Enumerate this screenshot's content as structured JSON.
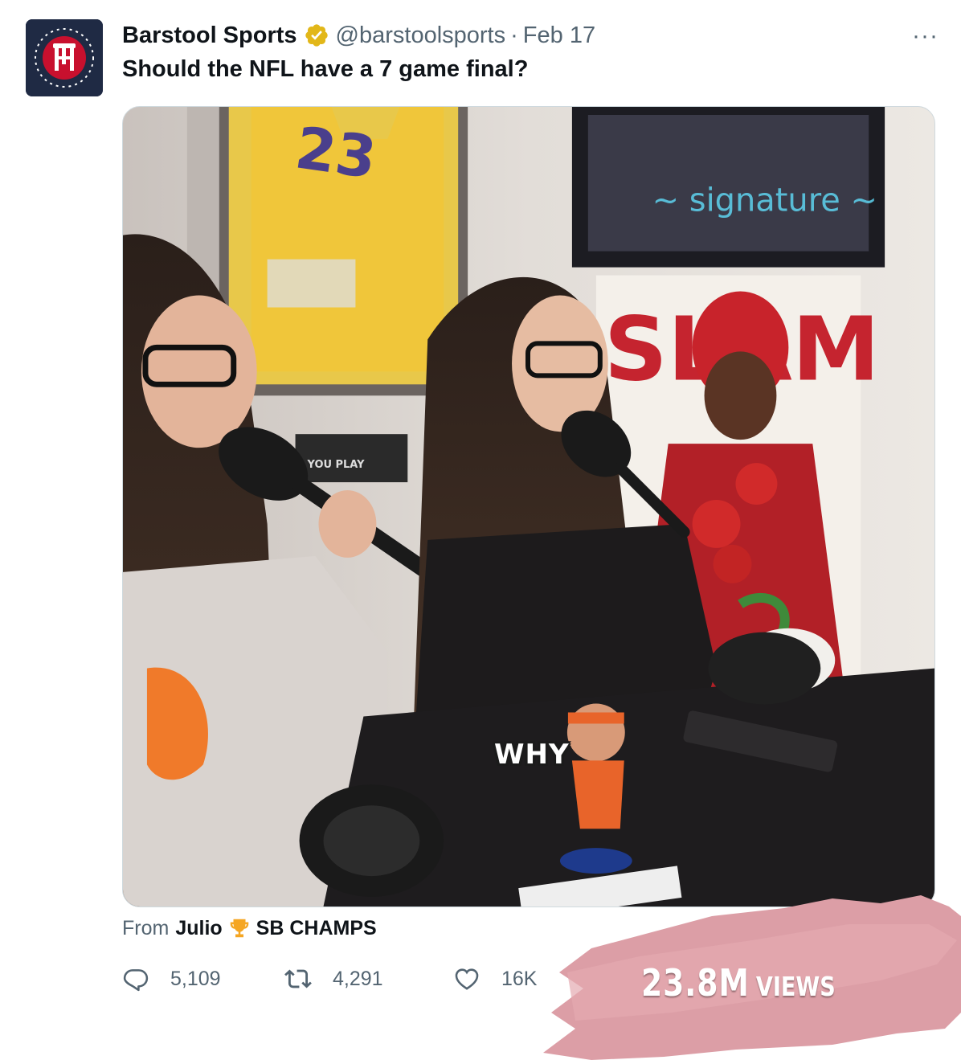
{
  "tweet": {
    "author_name": "Barstool Sports",
    "handle": "@barstoolsports",
    "separator": "·",
    "date": "Feb 17",
    "more_label": "···",
    "text": "Should the NFL have a 7 game final?",
    "video_caption": "WHY",
    "from_label": "From",
    "from_name": "Julio",
    "from_tag": "SB CHAMPS",
    "stats": {
      "replies": "5,109",
      "retweets": "4,291",
      "likes": "16K"
    },
    "views_number": "23.8M",
    "views_label": "VIEWS"
  },
  "icons": {
    "avatar": "barstool-logo-icon",
    "verified": "verified-badge-icon",
    "trophy": "trophy-icon",
    "reply": "reply-icon",
    "retweet": "retweet-icon",
    "like": "heart-icon"
  },
  "colors": {
    "text_primary": "#0f1419",
    "text_secondary": "#536471",
    "verified_gold": "#e2b719",
    "avatar_bg": "#1f2a44",
    "brush_pink": "#dc9ea6"
  }
}
